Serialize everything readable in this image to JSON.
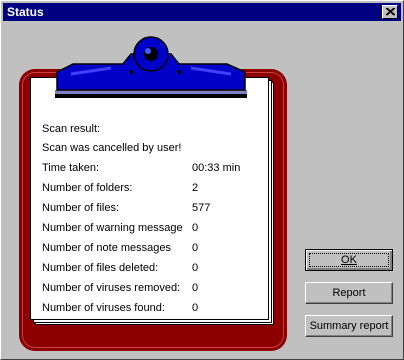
{
  "window": {
    "title": "Status"
  },
  "report": {
    "scan_result_label": "Scan result:",
    "status_message": "Scan was cancelled by user!",
    "rows": [
      {
        "label": "Time taken:",
        "value": "00:33 min"
      },
      {
        "label": "Number of folders:",
        "value": "2"
      },
      {
        "label": "Number of files:",
        "value": "577"
      },
      {
        "label": "Number of warning message",
        "value": "0"
      },
      {
        "label": "Number of note messages",
        "value": "0"
      },
      {
        "label": "Number of files deleted:",
        "value": "0"
      },
      {
        "label": "Number of viruses removed:",
        "value": "0"
      },
      {
        "label": "Number of viruses found:",
        "value": "0"
      }
    ]
  },
  "buttons": {
    "ok": "OK",
    "report": "Report",
    "summary": "Summary report"
  },
  "icons": {
    "close": "close-icon",
    "clip": "clipboard-clip-icon"
  },
  "colors": {
    "titlebar": "#000080",
    "clipboard": "#8c0000",
    "clip": "#0000c8",
    "face": "#c0c0c0"
  }
}
